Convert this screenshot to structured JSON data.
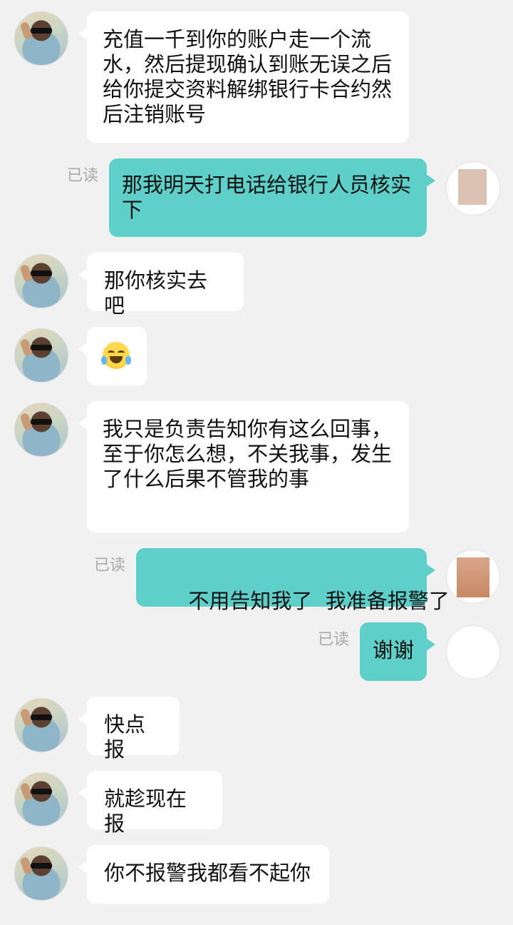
{
  "chat": {
    "read_label": "已读",
    "messages": [
      {
        "side": "received",
        "text": "充值一千到你的账户走一个流水，然后提现确认到账无误之后给你提交资料解绑银行卡合约然后注销账号"
      },
      {
        "side": "sent",
        "text": "那我明天打电话给银行人员核实下",
        "status": "已读"
      },
      {
        "side": "received",
        "text": "那你核实去吧"
      },
      {
        "side": "received",
        "text": "",
        "emoji": "laughing-crying-emoji"
      },
      {
        "side": "received",
        "text": "我只是负责告知你有这么回事，至于你怎么想，不关我事，发生了什么后果不管我的事"
      },
      {
        "side": "sent",
        "text": "不用告知我了  我准备报警了",
        "status": "已读"
      },
      {
        "side": "sent",
        "text": "谢谢",
        "status": "已读"
      },
      {
        "side": "received",
        "text": "快点报"
      },
      {
        "side": "received",
        "text": "就趁现在报"
      },
      {
        "side": "received",
        "text": "你不报警我都看不起你"
      }
    ]
  },
  "colors": {
    "background": "#f1f1f1",
    "received_bubble": "#ffffff",
    "sent_bubble": "#5ecfc9",
    "read_text": "#a9a9a9"
  }
}
